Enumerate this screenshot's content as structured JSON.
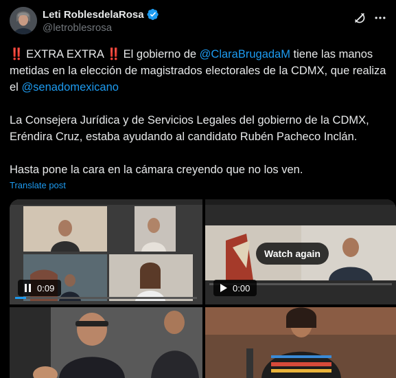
{
  "author": {
    "name": "Leti RoblesdelaRosa",
    "handle": "@letroblesrosa"
  },
  "post": {
    "alarm1": "‼️",
    "alarm2": "‼️",
    "p1_part1": " EXTRA EXTRA ",
    "p1_part2": " El gobierno de ",
    "mention1": "@ClaraBrugadaM",
    "p1_part3": " tiene las manos metidas en la elección de magistrados electorales de la CDMX, que realiza el ",
    "mention2": "@senadomexicano",
    "p2": "La Consejera Jurídica y de Servicios Legales del gobierno de la CDMX, Eréndira Cruz, estaba ayudando al candidato Rubén Pacheco Inclán.",
    "p3": "Hasta pone la cara en la cámara creyendo que no los ven.",
    "translate": "Translate post"
  },
  "media": {
    "video1_time": "0:09",
    "video2_time": "0:00",
    "watch_again": "Watch again"
  },
  "colors": {
    "accent": "#1d9bf0",
    "background": "#000000",
    "secondary_text": "#71767b"
  }
}
